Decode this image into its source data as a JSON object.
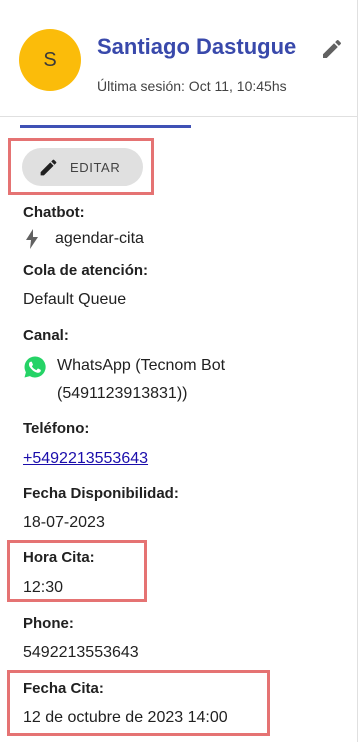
{
  "contact": {
    "avatar_initial": "S",
    "name": "Santiago Dastugue",
    "last_session": "Última sesión: Oct 11, 10:45hs"
  },
  "edit_button": {
    "label": "EDITAR"
  },
  "fields": {
    "chatbot": {
      "label": "Chatbot:",
      "value": "agendar-cita"
    },
    "queue": {
      "label": "Cola de atención:",
      "value": "Default Queue"
    },
    "channel": {
      "label": "Canal:",
      "value_line1": "WhatsApp (Tecnom Bot",
      "value_line2": "(5491123913831))"
    },
    "telefono": {
      "label": "Teléfono:",
      "value": "+5492213553643"
    },
    "fecha_disponibilidad": {
      "label": "Fecha Disponibilidad:",
      "value": "18-07-2023"
    },
    "hora_cita": {
      "label": "Hora Cita:",
      "value": "12:30"
    },
    "phone": {
      "label": "Phone:",
      "value": "5492213553643"
    },
    "fecha_cita": {
      "label": "Fecha Cita:",
      "value": "12 de octubre de 2023 14:00"
    }
  },
  "icons": {
    "edit": "pencil-icon",
    "chatbot": "bolt-icon",
    "channel": "whatsapp-icon"
  },
  "colors": {
    "avatar": "#fbbc0a",
    "name": "#3949ab",
    "highlight": "#e57373",
    "whatsapp": "#25d366",
    "link": "#1a0dab"
  }
}
